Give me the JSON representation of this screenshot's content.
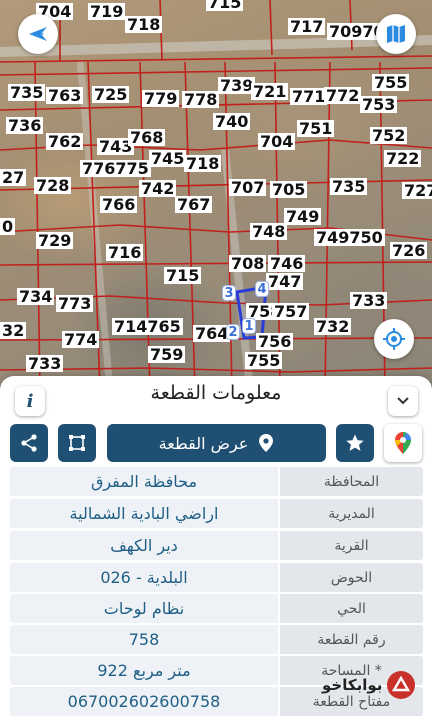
{
  "map": {
    "parcel_numbers": [
      {
        "text": "704"
      },
      {
        "text": "719"
      },
      {
        "text": "718"
      },
      {
        "text": "715"
      },
      {
        "text": "717"
      },
      {
        "text": "70970"
      },
      {
        "text": "735"
      },
      {
        "text": "763"
      },
      {
        "text": "725"
      },
      {
        "text": "779"
      },
      {
        "text": "778"
      },
      {
        "text": "739"
      },
      {
        "text": "721"
      },
      {
        "text": "771"
      },
      {
        "text": "772"
      },
      {
        "text": "755"
      },
      {
        "text": "753"
      },
      {
        "text": "736"
      },
      {
        "text": "740"
      },
      {
        "text": "751"
      },
      {
        "text": "752"
      },
      {
        "text": "762"
      },
      {
        "text": "743"
      },
      {
        "text": "768"
      },
      {
        "text": "704"
      },
      {
        "text": "745"
      },
      {
        "text": "718"
      },
      {
        "text": "722"
      },
      {
        "text": "27"
      },
      {
        "text": "728"
      },
      {
        "text": "776775"
      },
      {
        "text": "742"
      },
      {
        "text": "707"
      },
      {
        "text": "705"
      },
      {
        "text": "735"
      },
      {
        "text": "727"
      },
      {
        "text": "0"
      },
      {
        "text": "766"
      },
      {
        "text": "767"
      },
      {
        "text": "749"
      },
      {
        "text": "748"
      },
      {
        "text": "749750"
      },
      {
        "text": "726"
      },
      {
        "text": "729"
      },
      {
        "text": "716"
      },
      {
        "text": "708"
      },
      {
        "text": "746"
      },
      {
        "text": "715"
      },
      {
        "text": "747"
      },
      {
        "text": "734"
      },
      {
        "text": "773"
      },
      {
        "text": "733"
      },
      {
        "text": "758"
      },
      {
        "text": "757"
      },
      {
        "text": "32"
      },
      {
        "text": "774"
      },
      {
        "text": "714765"
      },
      {
        "text": "764"
      },
      {
        "text": "756"
      },
      {
        "text": "732"
      },
      {
        "text": "733"
      },
      {
        "text": "759"
      },
      {
        "text": "755"
      }
    ],
    "vertex_labels": [
      "3",
      "4",
      "2",
      "1"
    ],
    "compass_icon": "compass-icon",
    "layers_icon": "map-layers-icon",
    "locate_icon": "locate-icon"
  },
  "sheet": {
    "title": "معلومات القطعة",
    "view_parcel_label": "عرض القطعة",
    "info_icon": "info-icon",
    "collapse_icon": "chevron-down-icon"
  },
  "info": [
    {
      "label": "المحافظة",
      "value": "محافظة المفرق"
    },
    {
      "label": "المديرية",
      "value": "اراضي البادية الشمالية"
    },
    {
      "label": "القرية",
      "value": "دير الكهف"
    },
    {
      "label": "الحوض",
      "value": "البلدية - 026"
    },
    {
      "label": "الحي",
      "value": "نظام لوحات"
    },
    {
      "label": "رقم القطعة",
      "value": "758"
    },
    {
      "label": "المساحة *",
      "value": "922   متر مربع"
    },
    {
      "label": "مفتاح القطعة",
      "value": "067002602600758"
    }
  ],
  "watermark": {
    "text": "بوابكاخو"
  },
  "colors": {
    "button_dark": "#1f4f73",
    "value_text": "#1f5f86",
    "parcel_line": "#c0211c",
    "highlight": "#2a3cd6"
  }
}
